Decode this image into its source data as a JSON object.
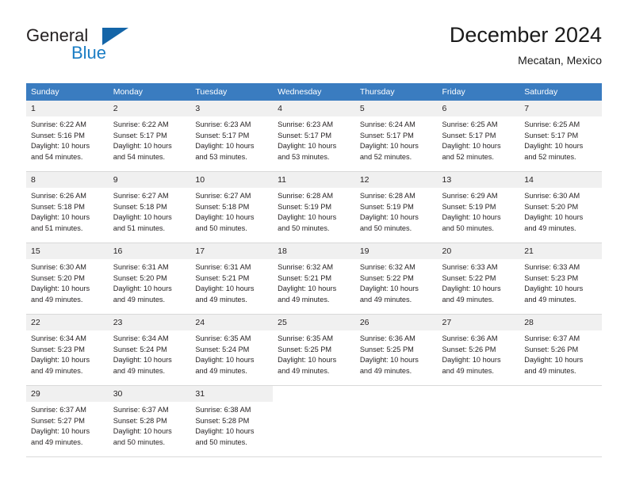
{
  "brand": {
    "word_general": "General",
    "word_blue": "Blue",
    "flag_color": "#1465a8",
    "blue_color": "#1a7dc4"
  },
  "header": {
    "title": "December 2024",
    "subtitle": "Mecatan, Mexico"
  },
  "theme": {
    "header_bg": "#3a7cc0",
    "daynum_bg": "#f0f0f0",
    "grid_line": "#d9d9d9",
    "text": "#231f20"
  },
  "weekday_headers": [
    "Sunday",
    "Monday",
    "Tuesday",
    "Wednesday",
    "Thursday",
    "Friday",
    "Saturday"
  ],
  "weeks": [
    [
      {
        "day": "1",
        "sunrise": "Sunrise: 6:22 AM",
        "sunset": "Sunset: 5:16 PM",
        "daylight1": "Daylight: 10 hours",
        "daylight2": "and 54 minutes."
      },
      {
        "day": "2",
        "sunrise": "Sunrise: 6:22 AM",
        "sunset": "Sunset: 5:17 PM",
        "daylight1": "Daylight: 10 hours",
        "daylight2": "and 54 minutes."
      },
      {
        "day": "3",
        "sunrise": "Sunrise: 6:23 AM",
        "sunset": "Sunset: 5:17 PM",
        "daylight1": "Daylight: 10 hours",
        "daylight2": "and 53 minutes."
      },
      {
        "day": "4",
        "sunrise": "Sunrise: 6:23 AM",
        "sunset": "Sunset: 5:17 PM",
        "daylight1": "Daylight: 10 hours",
        "daylight2": "and 53 minutes."
      },
      {
        "day": "5",
        "sunrise": "Sunrise: 6:24 AM",
        "sunset": "Sunset: 5:17 PM",
        "daylight1": "Daylight: 10 hours",
        "daylight2": "and 52 minutes."
      },
      {
        "day": "6",
        "sunrise": "Sunrise: 6:25 AM",
        "sunset": "Sunset: 5:17 PM",
        "daylight1": "Daylight: 10 hours",
        "daylight2": "and 52 minutes."
      },
      {
        "day": "7",
        "sunrise": "Sunrise: 6:25 AM",
        "sunset": "Sunset: 5:17 PM",
        "daylight1": "Daylight: 10 hours",
        "daylight2": "and 52 minutes."
      }
    ],
    [
      {
        "day": "8",
        "sunrise": "Sunrise: 6:26 AM",
        "sunset": "Sunset: 5:18 PM",
        "daylight1": "Daylight: 10 hours",
        "daylight2": "and 51 minutes."
      },
      {
        "day": "9",
        "sunrise": "Sunrise: 6:27 AM",
        "sunset": "Sunset: 5:18 PM",
        "daylight1": "Daylight: 10 hours",
        "daylight2": "and 51 minutes."
      },
      {
        "day": "10",
        "sunrise": "Sunrise: 6:27 AM",
        "sunset": "Sunset: 5:18 PM",
        "daylight1": "Daylight: 10 hours",
        "daylight2": "and 50 minutes."
      },
      {
        "day": "11",
        "sunrise": "Sunrise: 6:28 AM",
        "sunset": "Sunset: 5:19 PM",
        "daylight1": "Daylight: 10 hours",
        "daylight2": "and 50 minutes."
      },
      {
        "day": "12",
        "sunrise": "Sunrise: 6:28 AM",
        "sunset": "Sunset: 5:19 PM",
        "daylight1": "Daylight: 10 hours",
        "daylight2": "and 50 minutes."
      },
      {
        "day": "13",
        "sunrise": "Sunrise: 6:29 AM",
        "sunset": "Sunset: 5:19 PM",
        "daylight1": "Daylight: 10 hours",
        "daylight2": "and 50 minutes."
      },
      {
        "day": "14",
        "sunrise": "Sunrise: 6:30 AM",
        "sunset": "Sunset: 5:20 PM",
        "daylight1": "Daylight: 10 hours",
        "daylight2": "and 49 minutes."
      }
    ],
    [
      {
        "day": "15",
        "sunrise": "Sunrise: 6:30 AM",
        "sunset": "Sunset: 5:20 PM",
        "daylight1": "Daylight: 10 hours",
        "daylight2": "and 49 minutes."
      },
      {
        "day": "16",
        "sunrise": "Sunrise: 6:31 AM",
        "sunset": "Sunset: 5:20 PM",
        "daylight1": "Daylight: 10 hours",
        "daylight2": "and 49 minutes."
      },
      {
        "day": "17",
        "sunrise": "Sunrise: 6:31 AM",
        "sunset": "Sunset: 5:21 PM",
        "daylight1": "Daylight: 10 hours",
        "daylight2": "and 49 minutes."
      },
      {
        "day": "18",
        "sunrise": "Sunrise: 6:32 AM",
        "sunset": "Sunset: 5:21 PM",
        "daylight1": "Daylight: 10 hours",
        "daylight2": "and 49 minutes."
      },
      {
        "day": "19",
        "sunrise": "Sunrise: 6:32 AM",
        "sunset": "Sunset: 5:22 PM",
        "daylight1": "Daylight: 10 hours",
        "daylight2": "and 49 minutes."
      },
      {
        "day": "20",
        "sunrise": "Sunrise: 6:33 AM",
        "sunset": "Sunset: 5:22 PM",
        "daylight1": "Daylight: 10 hours",
        "daylight2": "and 49 minutes."
      },
      {
        "day": "21",
        "sunrise": "Sunrise: 6:33 AM",
        "sunset": "Sunset: 5:23 PM",
        "daylight1": "Daylight: 10 hours",
        "daylight2": "and 49 minutes."
      }
    ],
    [
      {
        "day": "22",
        "sunrise": "Sunrise: 6:34 AM",
        "sunset": "Sunset: 5:23 PM",
        "daylight1": "Daylight: 10 hours",
        "daylight2": "and 49 minutes."
      },
      {
        "day": "23",
        "sunrise": "Sunrise: 6:34 AM",
        "sunset": "Sunset: 5:24 PM",
        "daylight1": "Daylight: 10 hours",
        "daylight2": "and 49 minutes."
      },
      {
        "day": "24",
        "sunrise": "Sunrise: 6:35 AM",
        "sunset": "Sunset: 5:24 PM",
        "daylight1": "Daylight: 10 hours",
        "daylight2": "and 49 minutes."
      },
      {
        "day": "25",
        "sunrise": "Sunrise: 6:35 AM",
        "sunset": "Sunset: 5:25 PM",
        "daylight1": "Daylight: 10 hours",
        "daylight2": "and 49 minutes."
      },
      {
        "day": "26",
        "sunrise": "Sunrise: 6:36 AM",
        "sunset": "Sunset: 5:25 PM",
        "daylight1": "Daylight: 10 hours",
        "daylight2": "and 49 minutes."
      },
      {
        "day": "27",
        "sunrise": "Sunrise: 6:36 AM",
        "sunset": "Sunset: 5:26 PM",
        "daylight1": "Daylight: 10 hours",
        "daylight2": "and 49 minutes."
      },
      {
        "day": "28",
        "sunrise": "Sunrise: 6:37 AM",
        "sunset": "Sunset: 5:26 PM",
        "daylight1": "Daylight: 10 hours",
        "daylight2": "and 49 minutes."
      }
    ],
    [
      {
        "day": "29",
        "sunrise": "Sunrise: 6:37 AM",
        "sunset": "Sunset: 5:27 PM",
        "daylight1": "Daylight: 10 hours",
        "daylight2": "and 49 minutes."
      },
      {
        "day": "30",
        "sunrise": "Sunrise: 6:37 AM",
        "sunset": "Sunset: 5:28 PM",
        "daylight1": "Daylight: 10 hours",
        "daylight2": "and 50 minutes."
      },
      {
        "day": "31",
        "sunrise": "Sunrise: 6:38 AM",
        "sunset": "Sunset: 5:28 PM",
        "daylight1": "Daylight: 10 hours",
        "daylight2": "and 50 minutes."
      },
      null,
      null,
      null,
      null
    ]
  ]
}
